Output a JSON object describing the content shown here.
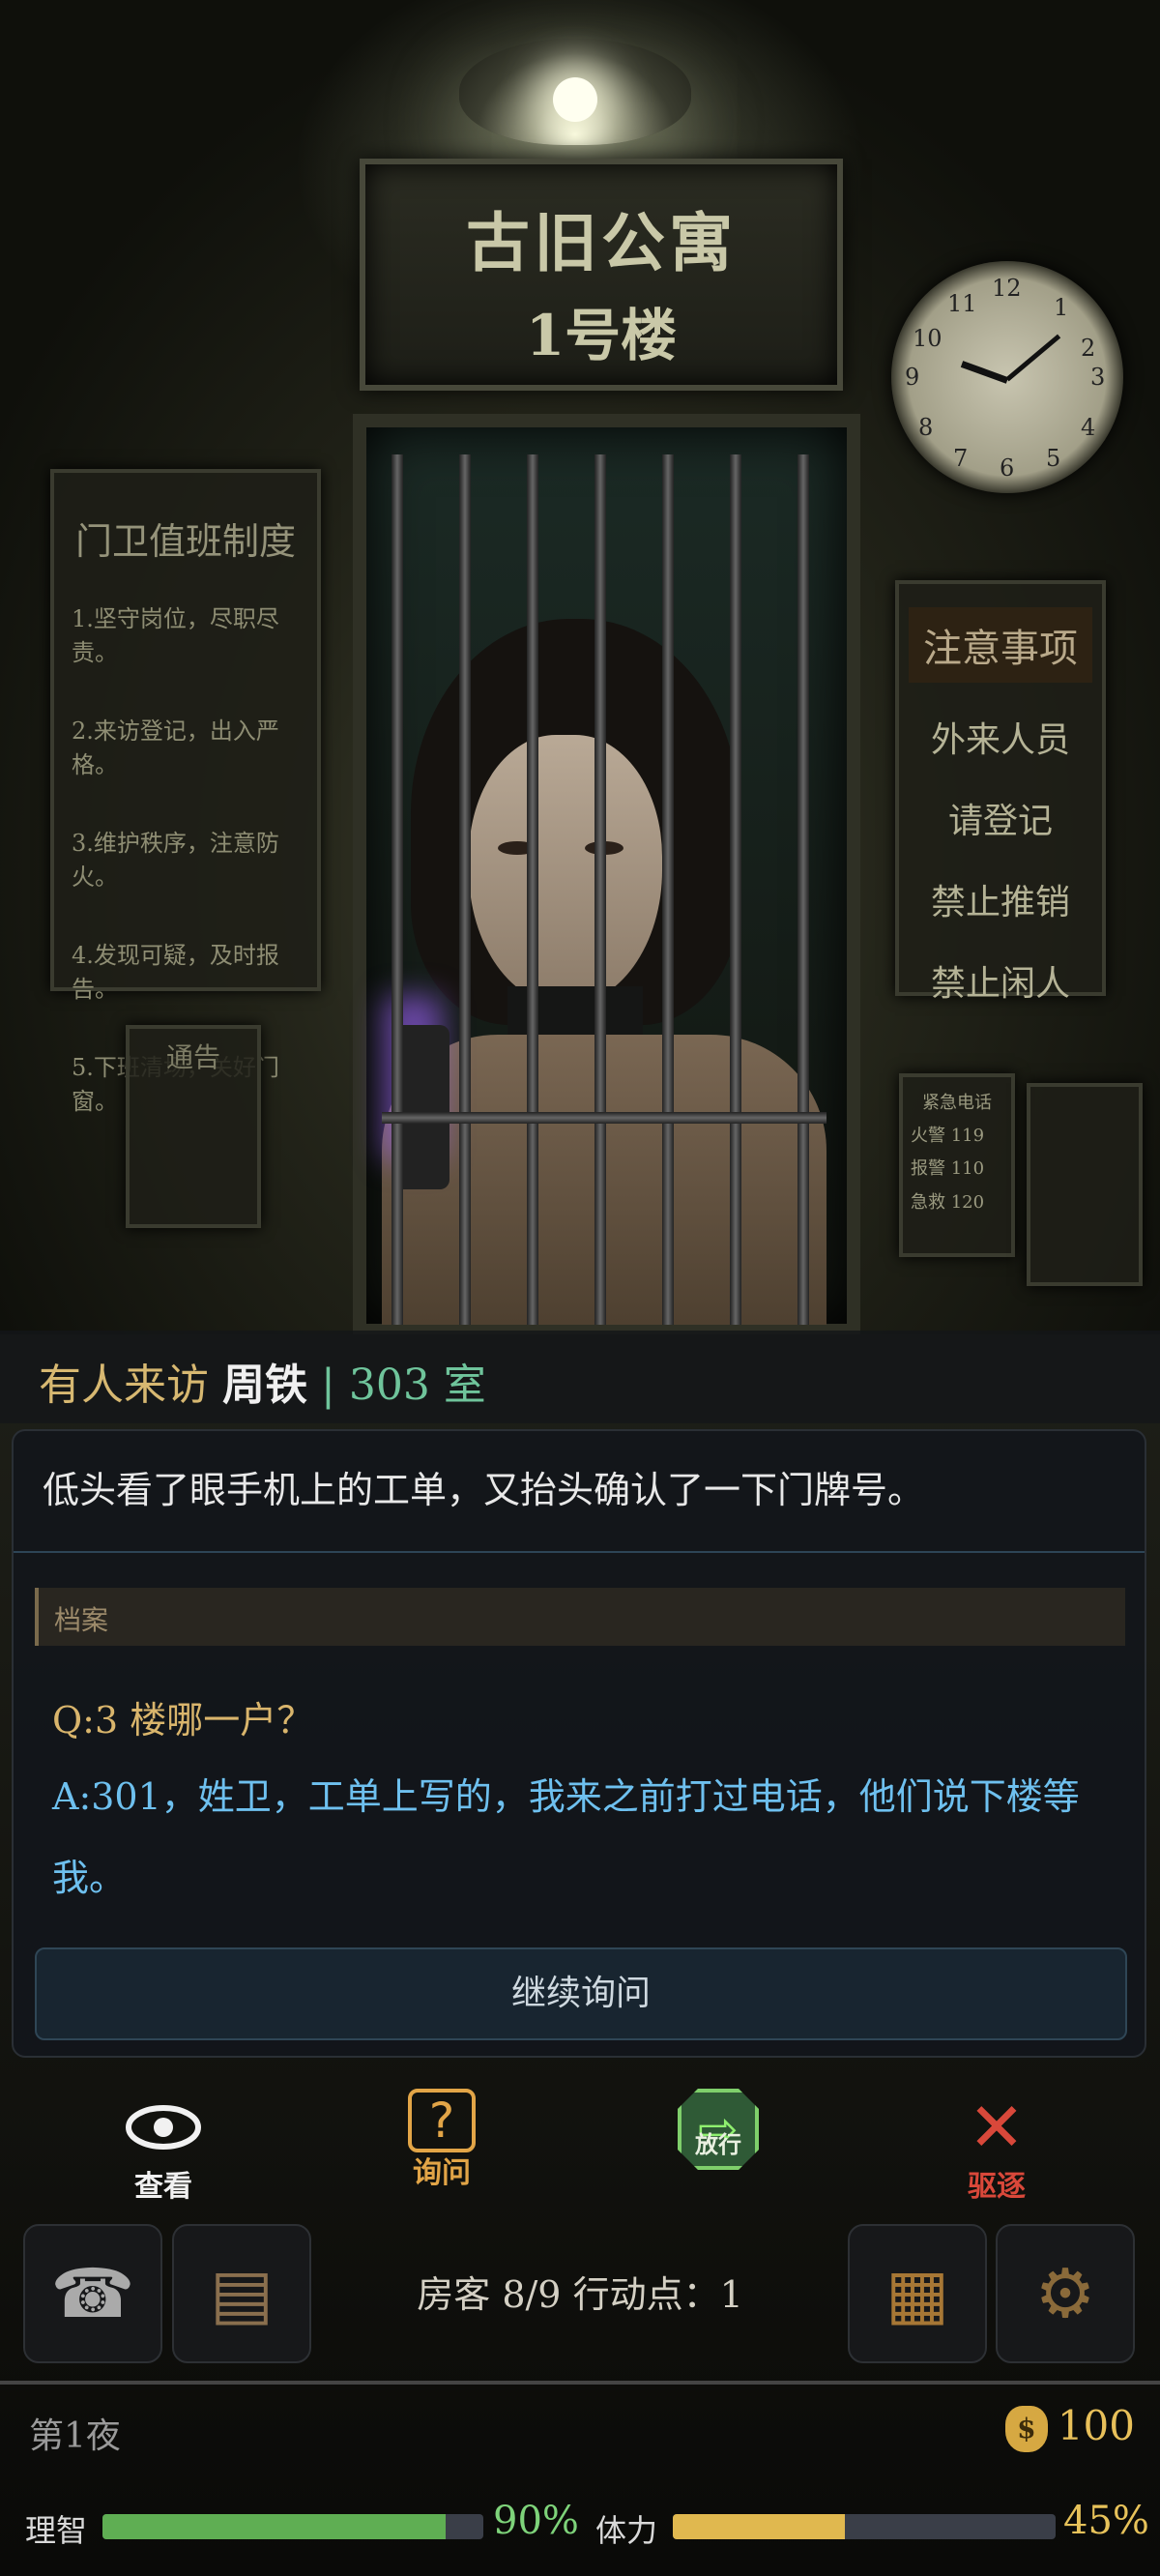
{
  "scene": {
    "sign_line1": "古旧公寓",
    "sign_line2": "1号楼",
    "duty_rules": {
      "title": "门卫值班制度",
      "items": [
        "1.坚守岗位，尽职尽责。",
        "2.来访登记，出入严格。",
        "3.维护秩序，注意防火。",
        "4.发现可疑，及时报告。",
        "5.下班清场，关好门窗。"
      ]
    },
    "notice_board": {
      "title": "注意事项",
      "items": [
        "外来人员",
        "请登记",
        "禁止推销",
        "禁止闲人"
      ]
    },
    "notice_paper": "通告",
    "emergency": {
      "title": "紧急电话",
      "items": [
        "火警  119",
        "报警  110",
        "急救  120"
      ]
    }
  },
  "visitor": {
    "prefix": "有人来访",
    "name": "周铁",
    "separator": "|",
    "room": "303 室"
  },
  "dialogue": {
    "narration": "低头看了眼手机上的工单，又抬头确认了一下门牌号。",
    "archive_label": "档案",
    "question": "Q:3 楼哪一户？",
    "answer": "A:301，姓卫，工单上写的，我来之前打过电话，他们说下楼等我。",
    "continue_label": "继续询问"
  },
  "actions": [
    {
      "label": "查看",
      "icon": "eye-icon",
      "color": "#f1f1f1"
    },
    {
      "label": "询问",
      "icon": "question-icon",
      "color": "#e2a547"
    },
    {
      "label": "放行",
      "icon": "arrow-right-icon",
      "color": "#8ff06f"
    },
    {
      "label": "驱逐",
      "icon": "cross-arrow-icon",
      "color": "#d9483a"
    }
  ],
  "toolbar": {
    "stats": "房客 8/9  行动点：1",
    "tiles": [
      "phone-icon",
      "book-icon",
      "toolbox-icon",
      "gear-icon"
    ]
  },
  "status": {
    "night": "第1夜",
    "money": "100",
    "sanity_label": "理智",
    "sanity_value": "90%",
    "sanity_fraction": 0.9,
    "stamina_label": "体力",
    "stamina_value": "45%",
    "stamina_fraction": 0.45
  },
  "colors": {
    "sanity": "#5fae53",
    "stamina": "#e0b84f",
    "accent_gold": "#d9b56c",
    "accent_blue": "#6ec0ef"
  }
}
